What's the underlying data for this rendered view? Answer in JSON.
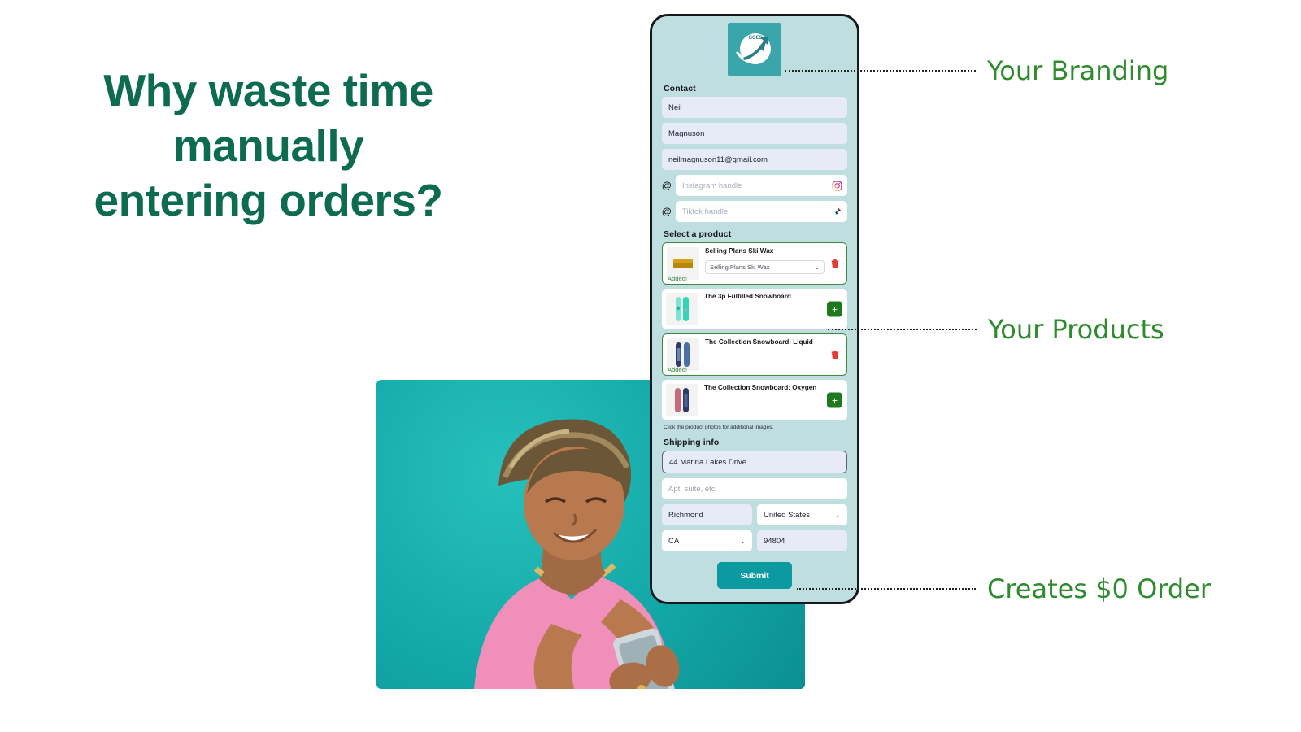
{
  "headline": {
    "line1": "Why waste time",
    "line2": "manually",
    "line3": "entering orders?"
  },
  "annotations": [
    {
      "label": "Your Branding",
      "color": "#2e8b2e"
    },
    {
      "label": "Your Products",
      "color": "#2e8b2e"
    },
    {
      "label": "Creates $0 Order",
      "color": "#2e8b2e"
    }
  ],
  "phone": {
    "logo": {
      "brand_text": "GOES",
      "icon": "rocket-arrow-globe-icon",
      "bg_color": "#3aa5aa"
    },
    "contact": {
      "section_title": "Contact",
      "first_name": "Neil",
      "last_name": "Magnuson",
      "email": "neilmagnuson11@gmail.com",
      "instagram_placeholder": "Instagram handle",
      "tiktok_placeholder": "Tiktok handle",
      "at_symbol": "@"
    },
    "products": {
      "section_title": "Select a product",
      "hint": "Click the product photos for additional images.",
      "items": [
        {
          "name": "Selling Plans Ski Wax",
          "variant": "Selling Plans Ski Wax",
          "state": "added",
          "status_label": "Added!",
          "action": "remove",
          "thumb": "ski-wax"
        },
        {
          "name": "The 3p Fulfilled Snowboard",
          "variant": "",
          "state": "available",
          "status_label": "",
          "action": "add",
          "thumb": "snowboard-mint"
        },
        {
          "name": "The Collection Snowboard: Liquid",
          "variant": "",
          "state": "added",
          "status_label": "Added!",
          "action": "remove",
          "thumb": "snowboard-blue"
        },
        {
          "name": "The Collection Snowboard: Oxygen",
          "variant": "",
          "state": "available",
          "status_label": "",
          "action": "add",
          "thumb": "snowboard-pink"
        }
      ]
    },
    "shipping": {
      "section_title": "Shipping info",
      "address1": "44 Marina Lakes Drive",
      "address2_placeholder": "Apt, suite, etc.",
      "city": "Richmond",
      "country": "United States",
      "state": "CA",
      "zip": "94804"
    },
    "submit_label": "Submit"
  },
  "colors": {
    "headline": "#0d6b4f",
    "annotation": "#2e8b2e",
    "phone_bg": "#bfdee0",
    "submit": "#0b9aa0",
    "add_button": "#1f7a1f",
    "delete": "#e53935",
    "field_filled": "#e7ebf7"
  }
}
